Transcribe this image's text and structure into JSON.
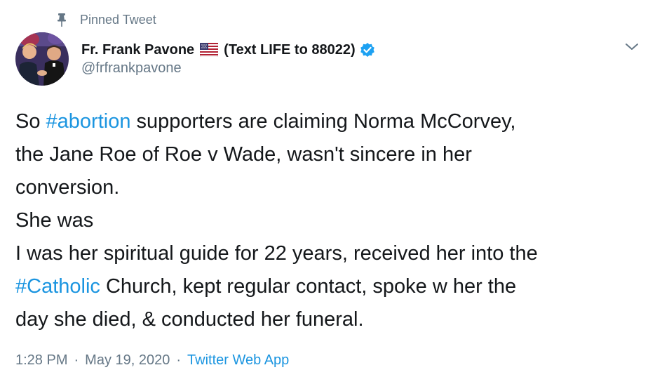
{
  "pinned": {
    "label": "Pinned Tweet",
    "icon": "pin-icon"
  },
  "author": {
    "name": "Fr. Frank Pavone",
    "name_extra": "(Text LIFE to 88022)",
    "handle": "@frfrankpavone",
    "flag_icon": "us-flag-icon",
    "verified_icon": "verified-badge-icon"
  },
  "tweet": {
    "lines": [
      [
        {
          "t": "So ",
          "tag": false
        },
        {
          "t": "#abortion",
          "tag": true
        },
        {
          "t": " supporters are claiming Norma McCorvey,",
          "tag": false
        }
      ],
      [
        {
          "t": "the Jane Roe of Roe v Wade, wasn't sincere in her",
          "tag": false
        }
      ],
      [
        {
          "t": "conversion.",
          "tag": false
        }
      ],
      [
        {
          "t": "She was",
          "tag": false
        }
      ],
      [
        {
          "t": "I was her spiritual guide for 22 years, received her into the",
          "tag": false
        }
      ],
      [
        {
          "t": "#Catholic",
          "tag": true
        },
        {
          "t": " Church, kept regular contact, spoke w her the",
          "tag": false
        }
      ],
      [
        {
          "t": "day she died, & conducted her funeral.",
          "tag": false
        }
      ]
    ]
  },
  "meta": {
    "time": "1:28 PM",
    "separator": "·",
    "date": "May 19, 2020",
    "source": "Twitter Web App"
  },
  "colors": {
    "link": "#1b95e0",
    "muted": "#657786",
    "text": "#14171a",
    "verified": "#1da1f2"
  }
}
